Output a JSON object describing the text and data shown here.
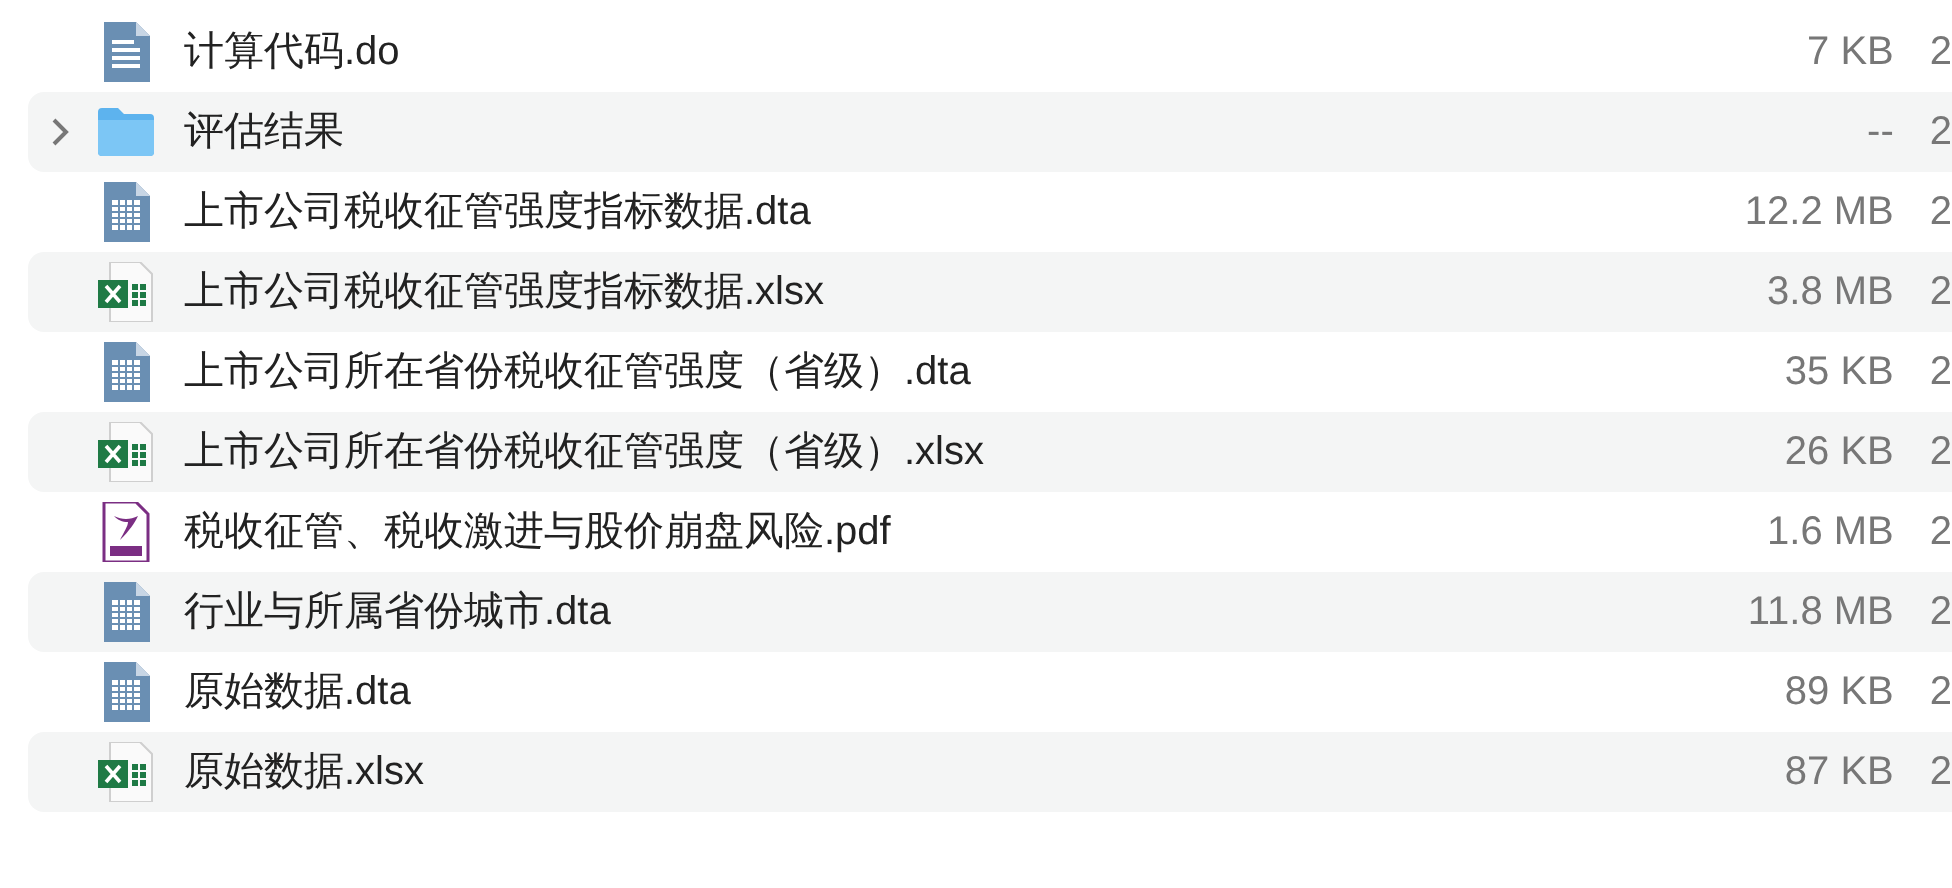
{
  "files": [
    {
      "kind": "do",
      "name": "计算代码.do",
      "size": "7 KB",
      "column_3": "2"
    },
    {
      "kind": "folder",
      "name": "评估结果",
      "size": "--",
      "column_3": "2",
      "expanded": false
    },
    {
      "kind": "dta",
      "name": "上市公司税收征管强度指标数据.dta",
      "size": "12.2 MB",
      "column_3": "2"
    },
    {
      "kind": "xlsx",
      "name": "上市公司税收征管强度指标数据.xlsx",
      "size": "3.8 MB",
      "column_3": "2"
    },
    {
      "kind": "dta",
      "name": "上市公司所在省份税收征管强度（省级）.dta",
      "size": "35 KB",
      "column_3": "2"
    },
    {
      "kind": "xlsx",
      "name": "上市公司所在省份税收征管强度（省级）.xlsx",
      "size": "26 KB",
      "column_3": "2"
    },
    {
      "kind": "pdf",
      "name": "税收征管、税收激进与股价崩盘风险.pdf",
      "size": "1.6 MB",
      "column_3": "2"
    },
    {
      "kind": "dta",
      "name": "行业与所属省份城市.dta",
      "size": "11.8 MB",
      "column_3": "2"
    },
    {
      "kind": "dta",
      "name": "原始数据.dta",
      "size": "89 KB",
      "column_3": "2"
    },
    {
      "kind": "xlsx",
      "name": "原始数据.xlsx",
      "size": "87 KB",
      "column_3": "2"
    }
  ]
}
